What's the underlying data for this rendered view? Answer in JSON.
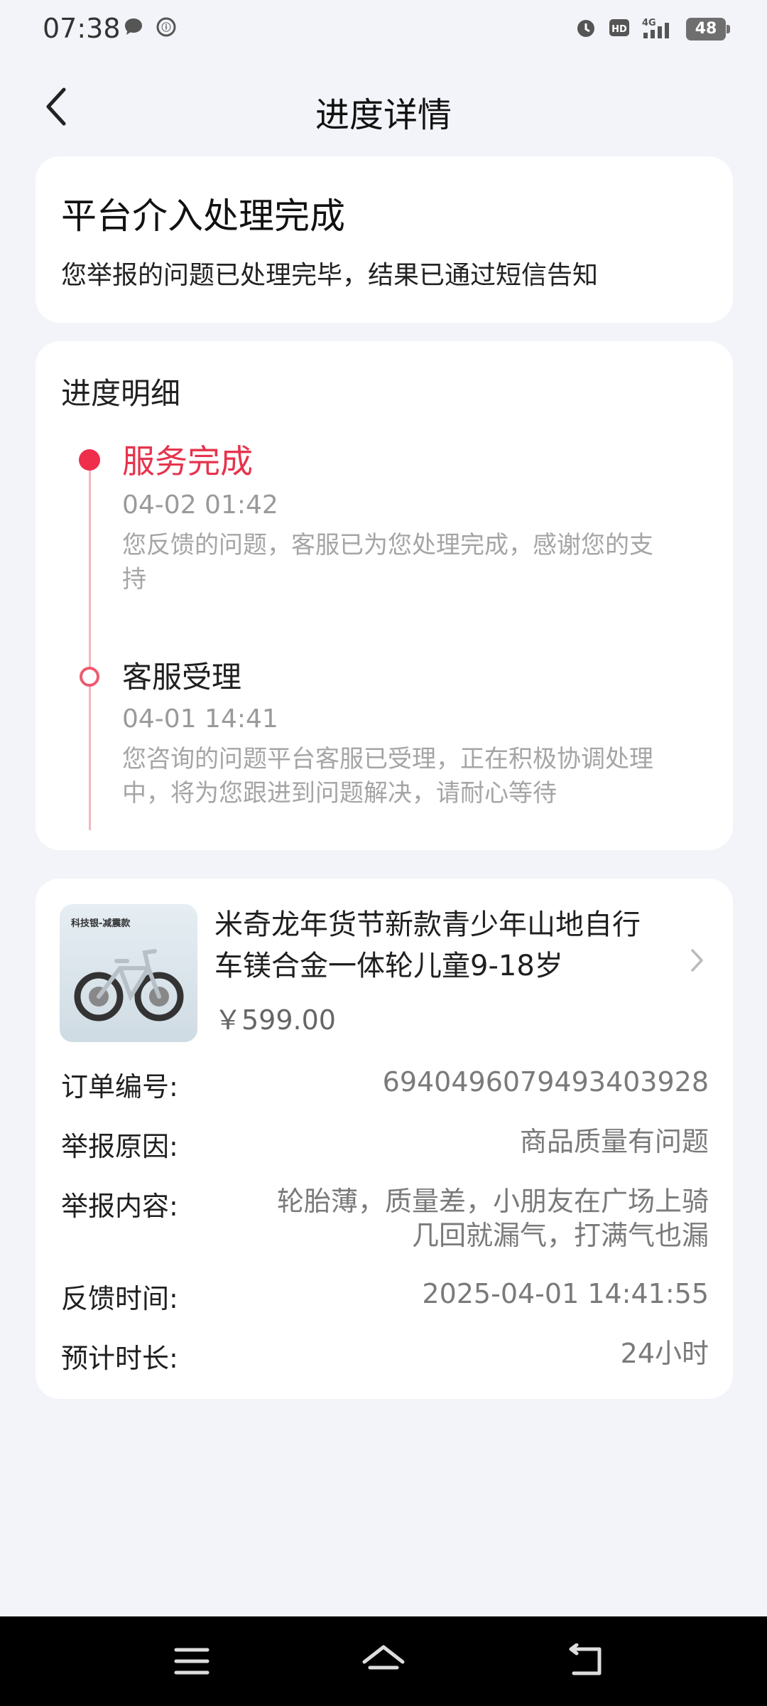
{
  "status": {
    "time": "07:38",
    "battery": "48",
    "network": "4G",
    "hd": "HD"
  },
  "header": {
    "title": "进度详情"
  },
  "result": {
    "title": "平台介入处理完成",
    "desc": "您举报的问题已处理完毕，结果已通过短信告知"
  },
  "progress": {
    "section_title": "进度明细",
    "items": [
      {
        "title": "服务完成",
        "time": "04-02 01:42",
        "desc_line1": "您反馈的问题，客服已为您处理完成，感谢您的支",
        "desc_line2": "持"
      },
      {
        "title": "客服受理",
        "time": "04-01 14:41",
        "desc_line1": "您咨询的问题平台客服已受理，正在积极协调处理",
        "desc_line2": "中，将为您跟进到问题解决，请耐心等待"
      }
    ]
  },
  "order": {
    "product_badge": "科技银-减震款",
    "product_name_line1": "米奇龙年货节新款青少年山地自行",
    "product_name_line2": "车镁合金一体轮儿童9-18岁",
    "price": "￥599.00",
    "rows": [
      {
        "label": "订单编号:",
        "value": "6940496079493403928"
      },
      {
        "label": "举报原因:",
        "value": "商品质量有问题"
      },
      {
        "label": "举报内容:",
        "value_line1": "轮胎薄，质量差，小朋友在广场上骑",
        "value_line2": "几回就漏气，打满气也漏"
      },
      {
        "label": "反馈时间:",
        "value": "2025-04-01 14:41:55"
      },
      {
        "label": "预计时长:",
        "value": "24小时"
      }
    ]
  },
  "colors": {
    "accent": "#e6344d",
    "background": "#f3f4f9",
    "card": "#ffffff"
  }
}
